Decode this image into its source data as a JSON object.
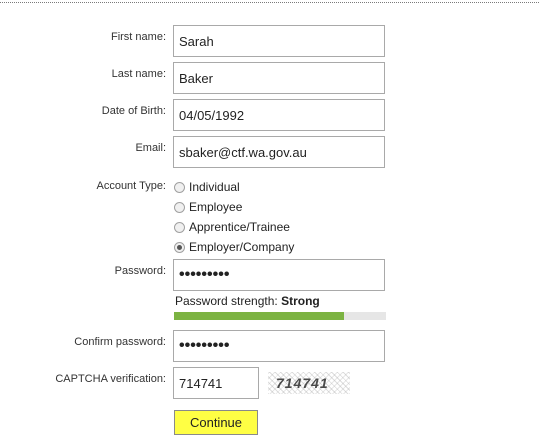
{
  "form": {
    "first_name": {
      "label": "First name:",
      "value": "Sarah"
    },
    "last_name": {
      "label": "Last name:",
      "value": "Baker"
    },
    "dob": {
      "label": "Date of Birth:",
      "value": "04/05/1992"
    },
    "email": {
      "label": "Email:",
      "value": "sbaker@ctf.wa.gov.au"
    },
    "account_type": {
      "label": "Account Type:",
      "options": [
        {
          "label": "Individual",
          "checked": false
        },
        {
          "label": "Employee",
          "checked": false
        },
        {
          "label": "Apprentice/Trainee",
          "checked": false
        },
        {
          "label": "Employer/Company",
          "checked": true
        }
      ]
    },
    "password": {
      "label": "Password:",
      "value": "•••••••••"
    },
    "password_strength": {
      "label": "Password strength:",
      "value": "Strong",
      "level_fraction": 0.8,
      "bar_color": "#7cb342"
    },
    "confirm_password": {
      "label": "Confirm password:",
      "value": "•••••••••"
    },
    "captcha": {
      "label": "CAPTCHA verification:",
      "value": "714741",
      "image_text": "714741"
    },
    "continue_label": "Continue",
    "highlight_color": "#ffff44"
  }
}
